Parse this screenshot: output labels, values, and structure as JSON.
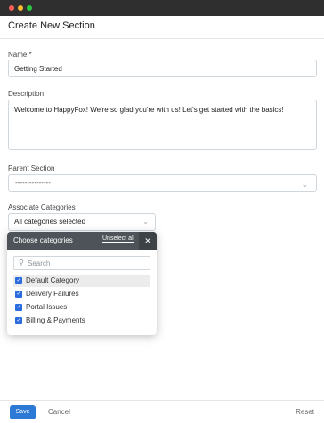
{
  "page": {
    "title": "Create New Section"
  },
  "name": {
    "label": "Name *",
    "value": "Getting Started"
  },
  "description": {
    "label": "Description",
    "value": "Welcome to HappyFox! We're so glad you're with us! Let's get started with the basics!"
  },
  "parent_section": {
    "label": "Parent Section",
    "value": "---------------",
    "chevron_icon": "chevron-down-icon"
  },
  "associate_categories": {
    "label": "Associate Categories",
    "value": "All categories selected",
    "chevron_icon": "chevron-down-icon"
  },
  "popover": {
    "title": "Choose categories",
    "unselect_all": "Unselect all",
    "close_icon": "close-icon",
    "search_placeholder": "Search",
    "options": [
      {
        "label": "Default Category",
        "checked": true
      },
      {
        "label": "Delivery Failures",
        "checked": true
      },
      {
        "label": "Portal Issues",
        "checked": true
      },
      {
        "label": "Billing & Payments",
        "checked": true
      }
    ]
  },
  "footer": {
    "save": "Save",
    "cancel": "Cancel",
    "reset": "Reset"
  },
  "colors": {
    "primary": "#2d7ad6",
    "popover_header": "#4d5358",
    "checkbox": "#2d6cdf"
  }
}
